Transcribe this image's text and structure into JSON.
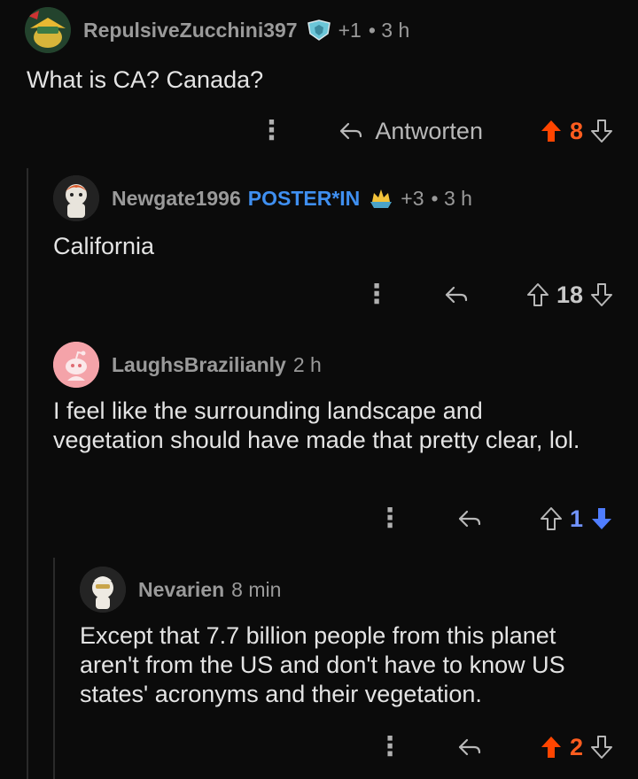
{
  "colors": {
    "background": "#0b0b0b",
    "upvote_active": "#ff4500",
    "downvote_active": "#4f7dff",
    "flair_blue": "#3f8ff0",
    "muted_text": "#9a9a9a"
  },
  "comments": [
    {
      "username": "RepulsiveZucchini397",
      "flair": "",
      "award_icon": "award-shield-icon",
      "karma_badge": "+1",
      "time": "• 3 h",
      "body": "What is CA? Canada?",
      "reply_label": "Antworten",
      "votes": "8",
      "vote_state": "upvoted"
    },
    {
      "username": "Newgate1996",
      "flair": "POSTER*IN",
      "award_icon": "award-crown-icon",
      "karma_badge": "+3",
      "time": "• 3 h",
      "body": "California",
      "reply_label": "",
      "votes": "18",
      "vote_state": "none"
    },
    {
      "username": "LaughsBrazilianly",
      "flair": "",
      "time": "2 h",
      "body": "I feel like the surrounding landscape and vegetation should have made that pretty clear, lol.",
      "reply_label": "",
      "votes": "1",
      "vote_state": "downvoted"
    },
    {
      "username": "Nevarien",
      "flair": "",
      "time": "8 min",
      "body": "Except that 7.7 billion people from this planet aren't from the US and don't have to know US states' acronyms and their vegetation.",
      "reply_label": "",
      "votes": "2",
      "vote_state": "upvoted"
    }
  ]
}
